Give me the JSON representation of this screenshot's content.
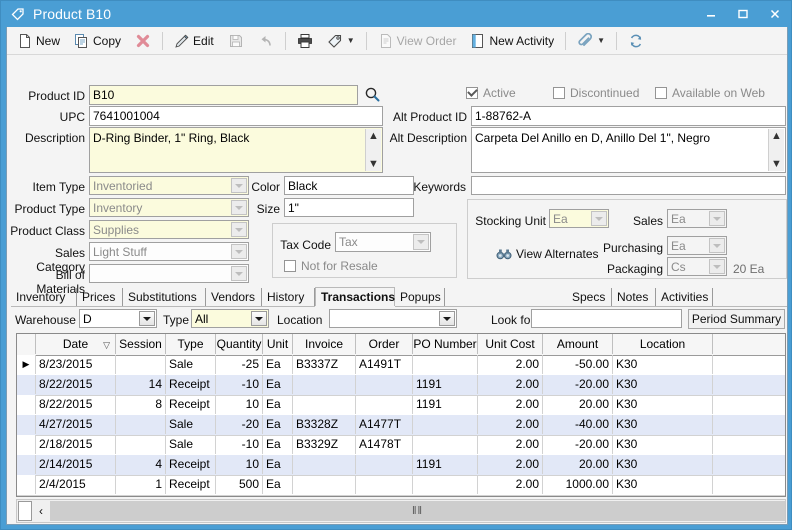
{
  "window": {
    "title": "Product B10",
    "icon": "tag-icon",
    "minimize": "minimize-button",
    "maximize": "maximize-button",
    "close": "close-button",
    "accent": "#4a9ed4"
  },
  "toolbar": {
    "items": [
      {
        "label": "New",
        "icon": "new-document-icon",
        "disabled": false
      },
      {
        "label": "Copy",
        "icon": "copy-icon",
        "disabled": false
      },
      {
        "label": "",
        "icon": "delete-x-icon",
        "disabled": false
      },
      {
        "label": "Edit",
        "icon": "pencil-icon",
        "disabled": false
      },
      {
        "label": "",
        "icon": "save-disk-icon",
        "disabled": true
      },
      {
        "label": "",
        "icon": "undo-arrow-icon",
        "disabled": true
      },
      {
        "label": "",
        "icon": "printer-icon",
        "disabled": false
      },
      {
        "label": "",
        "icon": "tag-icon",
        "disabled": false,
        "caret": true
      },
      {
        "label": "View Order",
        "icon": "document-icon",
        "disabled": true
      },
      {
        "label": "New Activity",
        "icon": "activity-icon",
        "disabled": false
      },
      {
        "label": "",
        "icon": "paperclip-icon",
        "disabled": false,
        "caret": true
      },
      {
        "label": "",
        "icon": "refresh-icon",
        "disabled": false
      }
    ]
  },
  "form": {
    "product_id_label": "Product ID",
    "product_id_value": "B10",
    "search_icon": "magnifier-icon",
    "upc_label": "UPC",
    "upc_value": "7641001004",
    "description_label": "Description",
    "description_value": "D-Ring Binder, 1\" Ring, Black",
    "active_label": "Active",
    "active_checked": true,
    "discontinued_label": "Discontinued",
    "discontinued_checked": false,
    "available_web_label": "Available on Web",
    "available_web_checked": false,
    "alt_product_id_label": "Alt Product ID",
    "alt_product_id_value": "1-88762-A",
    "alt_description_label": "Alt Description",
    "alt_description_value": "Carpeta Del Anillo en D, Anillo Del 1\", Negro",
    "item_type_label": "Item Type",
    "item_type_value": "Inventoried",
    "product_type_label": "Product Type",
    "product_type_value": "Inventory",
    "product_class_label": "Product Class",
    "product_class_value": "Supplies",
    "sales_category_label": "Sales Category",
    "sales_category_value": "Light Stuff",
    "bill_of_materials_label": "Bill of Materials",
    "bill_of_materials_value": "",
    "color_label": "Color",
    "color_value": "Black",
    "size_label": "Size",
    "size_value": "1\"",
    "keywords_label": "Keywords",
    "keywords_value": "",
    "tax_code_label": "Tax Code",
    "tax_code_value": "Tax",
    "not_for_resale_label": "Not for Resale",
    "not_for_resale_checked": false,
    "stocking_unit_label": "Stocking Unit",
    "stocking_unit_value": "Ea",
    "sales_unit_label": "Sales",
    "sales_unit_value": "Ea",
    "purchasing_unit_label": "Purchasing",
    "purchasing_unit_value": "Ea",
    "packaging_unit_label": "Packaging",
    "packaging_unit_value": "Cs",
    "packaging_qty": "20 Ea",
    "view_alternates_label": "View Alternates",
    "view_alternates_icon": "binoculars-icon"
  },
  "tabs": {
    "left": [
      {
        "label": "Inventory",
        "selected": false
      },
      {
        "label": "Prices",
        "selected": false
      },
      {
        "label": "Substitutions",
        "selected": false
      },
      {
        "label": "Vendors",
        "selected": false
      },
      {
        "label": "History",
        "selected": false
      },
      {
        "label": "Transactions",
        "selected": true
      },
      {
        "label": "Popups",
        "selected": false
      }
    ],
    "right": [
      {
        "label": "Specs",
        "selected": false
      },
      {
        "label": "Notes",
        "selected": false
      },
      {
        "label": "Activities",
        "selected": false
      }
    ]
  },
  "filters": {
    "warehouse_label": "Warehouse",
    "warehouse_value": "D",
    "type_label": "Type",
    "type_value": "All",
    "location_label": "Location",
    "location_value": "",
    "look_for_label": "Look for",
    "look_for_value": "",
    "period_summary_label": "Period Summary"
  },
  "grid": {
    "columns": [
      {
        "label": "Date",
        "sorted": true
      },
      {
        "label": "Session"
      },
      {
        "label": "Type"
      },
      {
        "label": "Quantity"
      },
      {
        "label": "Unit"
      },
      {
        "label": "Invoice"
      },
      {
        "label": "Order"
      },
      {
        "label": "PO Number"
      },
      {
        "label": "Unit Cost"
      },
      {
        "label": "Amount"
      },
      {
        "label": "Location"
      },
      {
        "label": ""
      }
    ],
    "rows": [
      {
        "current": true,
        "date": "8/23/2015",
        "session": "",
        "type": "Sale",
        "quantity": "-25",
        "unit": "Ea",
        "invoice": "B3337Z",
        "order": "A1491T",
        "po": "",
        "unit_cost": "2.00",
        "amount": "-50.00",
        "location": "K30"
      },
      {
        "current": false,
        "date": "8/22/2015",
        "session": "14",
        "type": "Receipt",
        "quantity": "-10",
        "unit": "Ea",
        "invoice": "",
        "order": "",
        "po": "1191",
        "unit_cost": "2.00",
        "amount": "-20.00",
        "location": "K30"
      },
      {
        "current": false,
        "date": "8/22/2015",
        "session": "8",
        "type": "Receipt",
        "quantity": "10",
        "unit": "Ea",
        "invoice": "",
        "order": "",
        "po": "1191",
        "unit_cost": "2.00",
        "amount": "20.00",
        "location": "K30"
      },
      {
        "current": false,
        "date": "4/27/2015",
        "session": "",
        "type": "Sale",
        "quantity": "-20",
        "unit": "Ea",
        "invoice": "B3328Z",
        "order": "A1477T",
        "po": "",
        "unit_cost": "2.00",
        "amount": "-40.00",
        "location": "K30"
      },
      {
        "current": false,
        "date": "2/18/2015",
        "session": "",
        "type": "Sale",
        "quantity": "-10",
        "unit": "Ea",
        "invoice": "B3329Z",
        "order": "A1478T",
        "po": "",
        "unit_cost": "2.00",
        "amount": "-20.00",
        "location": "K30"
      },
      {
        "current": false,
        "date": "2/14/2015",
        "session": "4",
        "type": "Receipt",
        "quantity": "10",
        "unit": "Ea",
        "invoice": "",
        "order": "",
        "po": "1191",
        "unit_cost": "2.00",
        "amount": "20.00",
        "location": "K30"
      },
      {
        "current": false,
        "date": "2/4/2015",
        "session": "1",
        "type": "Receipt",
        "quantity": "500",
        "unit": "Ea",
        "invoice": "",
        "order": "",
        "po": "",
        "unit_cost": "2.00",
        "amount": "1000.00",
        "location": "K30"
      }
    ]
  },
  "scrollbar": {
    "left_arrow": "‹",
    "grip": "‖‖"
  }
}
